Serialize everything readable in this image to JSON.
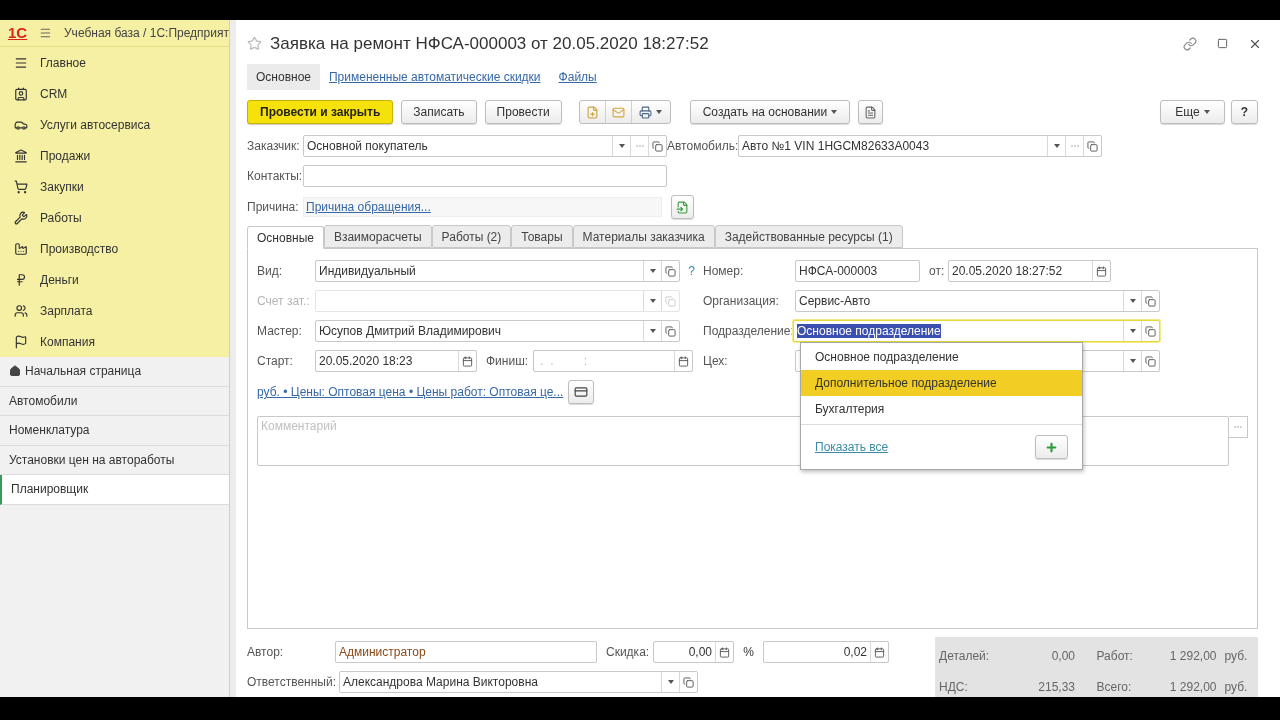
{
  "app": {
    "logo": "1С",
    "title": "Учебная база / 1С:Предприят"
  },
  "sections": [
    {
      "label": "Главное"
    },
    {
      "label": "CRM"
    },
    {
      "label": "Услуги автосервиса"
    },
    {
      "label": "Продажи"
    },
    {
      "label": "Закупки"
    },
    {
      "label": "Работы"
    },
    {
      "label": "Производство"
    },
    {
      "label": "Деньги"
    },
    {
      "label": "Зарплата"
    },
    {
      "label": "Компания"
    }
  ],
  "nav": [
    {
      "label": "Начальная страница",
      "kind": "home",
      "selected": false
    },
    {
      "label": "Автомобили",
      "kind": "link",
      "selected": false
    },
    {
      "label": "Номенклатура",
      "kind": "link",
      "selected": false
    },
    {
      "label": "Установки цен на автоработы",
      "kind": "link",
      "selected": false
    },
    {
      "label": "Планировщик",
      "kind": "link",
      "selected": true
    }
  ],
  "document": {
    "title": "Заявка на ремонт НФСА-000003 от 20.05.2020 18:27:52"
  },
  "form_tabs": [
    {
      "label": "Основное",
      "selected": true
    },
    {
      "label": "Примененные автоматические скидки",
      "selected": false
    },
    {
      "label": "Файлы",
      "selected": false
    }
  ],
  "toolbar": {
    "primary": "Провести и закрыть",
    "buttons": [
      "Записать",
      "Провести"
    ],
    "create_based": "Создать на основании",
    "more": "Еще",
    "help": "?"
  },
  "header": {
    "customer": {
      "label": "Заказчик:",
      "value": "Основной покупатель"
    },
    "car": {
      "label": "Автомобиль:",
      "value": "Авто №1 VIN 1HGCM82633A0043"
    },
    "contacts": {
      "label": "Контакты:"
    },
    "reason": {
      "label": "Причина:",
      "link": "Причина обращения..."
    }
  },
  "tabs": [
    {
      "label": "Основные",
      "selected": true
    },
    {
      "label": "Взаиморасчеты",
      "selected": false
    },
    {
      "label": "Работы (2)",
      "selected": false
    },
    {
      "label": "Товары",
      "selected": false
    },
    {
      "label": "Материалы заказчика",
      "selected": false
    },
    {
      "label": "Задействованные ресурсы (1)",
      "selected": false
    }
  ],
  "main": {
    "kind_field": {
      "label": "Вид:",
      "value": "Индивидуальный",
      "help": "?"
    },
    "cost_account": {
      "label": "Счет зат.:",
      "disabled": true
    },
    "master": {
      "label": "Мастер:",
      "value": "Юсупов Дмитрий Владимирович"
    },
    "start": {
      "label": "Старт:",
      "value": "20.05.2020 18:23"
    },
    "finish": {
      "label": "Финиш:",
      "placeholder": " .  .         :  "
    },
    "number": {
      "label": "Номер:",
      "value": "НФСА-000003"
    },
    "date": {
      "label": "от:",
      "value": "20.05.2020 18:27:52"
    },
    "organization": {
      "label": "Организация:",
      "value": "Сервис-Авто"
    },
    "department": {
      "label": "Подразделение:",
      "value": "Основное подразделение",
      "focused": true
    },
    "workshop": {
      "label": "Цех:"
    },
    "prices_link": "руб. • Цены: Оптовая цена • Цены работ: Оптовая це...",
    "comment": {
      "placeholder": "Комментарий"
    }
  },
  "dropdown": {
    "items": [
      {
        "label": "Основное подразделение",
        "selected": false
      },
      {
        "label": "Дополнительное подразделение",
        "selected": true
      },
      {
        "label": "Бухгалтерия",
        "selected": false
      }
    ],
    "show_all": "Показать все"
  },
  "footer": {
    "author": {
      "label": "Автор:",
      "value": "Администратор"
    },
    "discount": {
      "label": "Скидка:",
      "value": "0,00",
      "unit": "%",
      "percent": "0,02"
    },
    "responsible": {
      "label": "Ответственный:",
      "value": "Александрова Марина Викторовна"
    },
    "totals": [
      {
        "label": "Деталей:",
        "value": "0,00"
      },
      {
        "label": "Работ:",
        "value": "1 292,00",
        "unit": "руб."
      },
      {
        "label": "НДС:",
        "value": "215,33"
      },
      {
        "label": "Всего:",
        "value": "1 292,00",
        "unit": "руб."
      }
    ]
  }
}
